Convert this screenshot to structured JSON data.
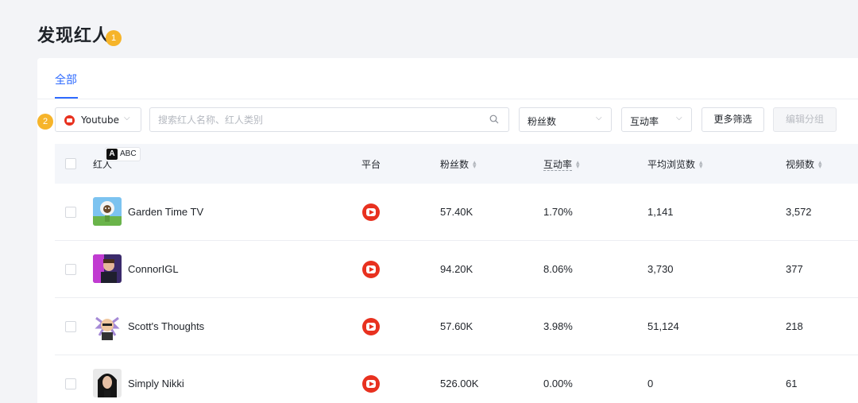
{
  "page": {
    "title": "发现红人",
    "badge1": "1",
    "badge2": "2"
  },
  "tabs": [
    {
      "label": "全部",
      "active": true
    }
  ],
  "filters": {
    "platform": {
      "value": "Youtube",
      "icon": "youtube-icon"
    },
    "search": {
      "placeholder": "搜索红人名称、红人类别",
      "value": ""
    },
    "fans": {
      "value": "粉丝数"
    },
    "engagement": {
      "value": "互动率"
    },
    "more_label": "更多筛选",
    "edit_group_label": "编辑分组"
  },
  "tooltip": {
    "letter": "A",
    "text": "ABC"
  },
  "table": {
    "columns": {
      "influencer": "红人",
      "platform": "平台",
      "fans": "粉丝数",
      "engagement": "互动率",
      "avg_views": "平均浏览数",
      "videos": "视频数"
    },
    "rows": [
      {
        "name": "Garden Time TV",
        "platform": "youtube-icon",
        "fans": "57.40K",
        "engagement": "1.70%",
        "avg_views": "1,141",
        "videos": "3,572"
      },
      {
        "name": "ConnorIGL",
        "platform": "youtube-icon",
        "fans": "94.20K",
        "engagement": "8.06%",
        "avg_views": "3,730",
        "videos": "377"
      },
      {
        "name": "Scott's Thoughts",
        "platform": "youtube-icon",
        "fans": "57.60K",
        "engagement": "3.98%",
        "avg_views": "51,124",
        "videos": "218"
      },
      {
        "name": "Simply Nikki",
        "platform": "youtube-icon",
        "fans": "526.00K",
        "engagement": "0.00%",
        "avg_views": "0",
        "videos": "61"
      }
    ]
  },
  "colors": {
    "accent": "#2f6bff",
    "youtube": "#e8311f",
    "badge": "#f6b42a"
  }
}
